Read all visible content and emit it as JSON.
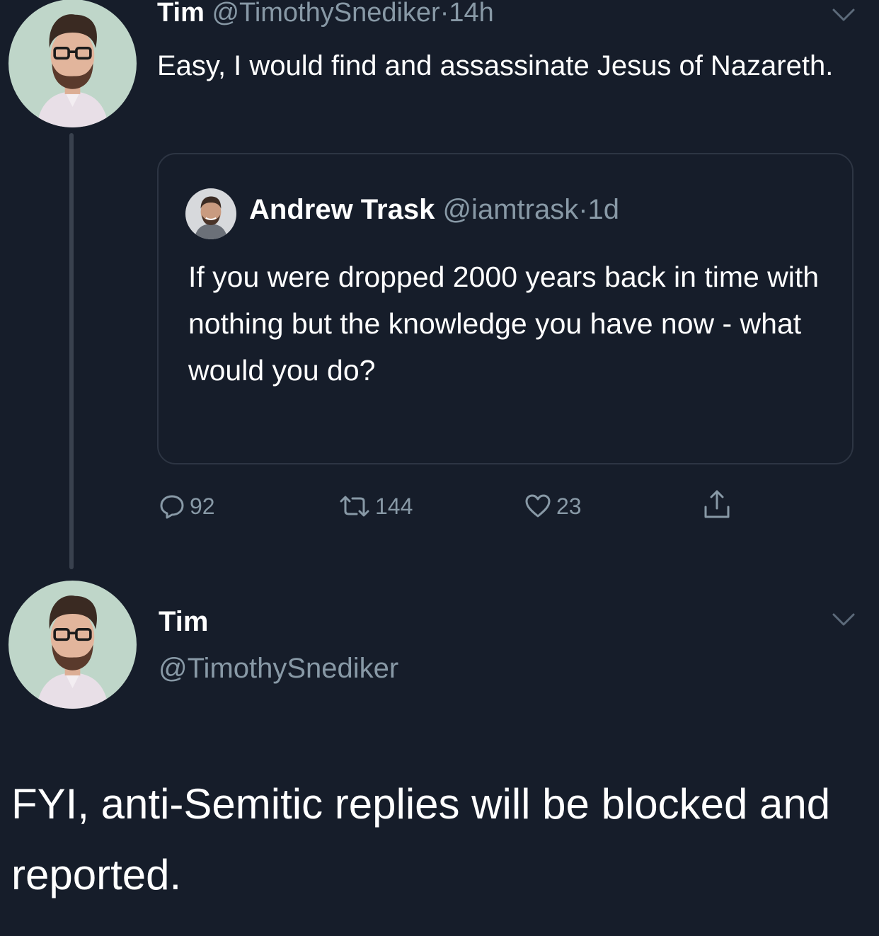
{
  "tweet1": {
    "name": "Tim",
    "handle": "@TimothySnediker",
    "separator": "·",
    "time": "14h",
    "text": "Easy, I would find and assassinate Jesus of Nazareth.",
    "avatar": "profile-photo"
  },
  "quote": {
    "name": "Andrew Trask",
    "handle": "@iamtrask",
    "separator": "·",
    "time": "1d",
    "text": "If you were dropped 2000 years back in time with nothing but the knowledge you have now - what would you do?",
    "avatar": "profile-photo"
  },
  "actions": {
    "reply": {
      "icon": "reply-icon",
      "count": "92"
    },
    "retweet": {
      "icon": "retweet-icon",
      "count": "144"
    },
    "like": {
      "icon": "heart-icon",
      "count": "23"
    },
    "share": {
      "icon": "share-icon"
    }
  },
  "tweet2": {
    "name": "Tim",
    "handle": "@TimothySnediker",
    "text": "FYI, anti-Semitic replies will be blocked and reported.",
    "avatar": "profile-photo"
  },
  "colors": {
    "background": "#161d2a",
    "text": "#ffffff",
    "muted": "#8899a6",
    "border": "#2d3543",
    "thread_line": "#39414e"
  }
}
